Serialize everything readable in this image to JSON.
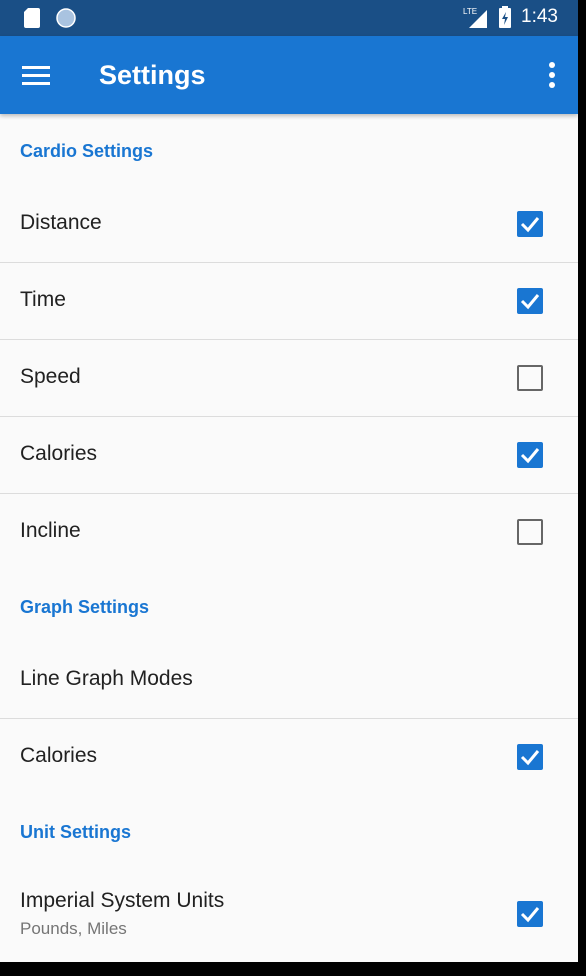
{
  "status_bar": {
    "time": "1:43",
    "network": "LTE"
  },
  "app_bar": {
    "title": "Settings"
  },
  "sections": [
    {
      "header": "Cardio Settings",
      "items": [
        {
          "label": "Distance",
          "checked": true
        },
        {
          "label": "Time",
          "checked": true
        },
        {
          "label": "Speed",
          "checked": false
        },
        {
          "label": "Calories",
          "checked": true
        },
        {
          "label": "Incline",
          "checked": false
        }
      ]
    },
    {
      "header": "Graph Settings",
      "items": [
        {
          "label": "Line Graph Modes"
        },
        {
          "label": "Calories",
          "checked": true
        }
      ]
    },
    {
      "header": "Unit Settings",
      "items": [
        {
          "label": "Imperial System Units",
          "summary": "Pounds, Miles",
          "checked": true
        }
      ]
    }
  ],
  "colors": {
    "accent": "#1976d2",
    "status_bar": "#1a4f86",
    "background": "#fafafa"
  },
  "icons": [
    "sd-card-icon",
    "sync-icon",
    "lte-signal-icon",
    "battery-charging-icon",
    "menu-icon",
    "more-vert-icon",
    "checkbox-checked-icon",
    "checkbox-unchecked-icon"
  ]
}
